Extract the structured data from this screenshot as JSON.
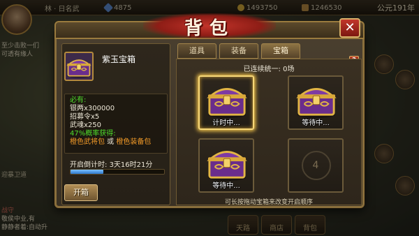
{
  "hud": {
    "resource_gems": "4875",
    "resource_silver": "1493750",
    "resource_grain": "1246530",
    "year": "公元191年",
    "partial_text": "林 · 日名武"
  },
  "background_text": {
    "line1": "至少击败一们",
    "line2": "可透有缘人",
    "line3": "迎暴卫道",
    "line4": "战守",
    "line5": "敬侯中业,有",
    "line6": "静静者着:自动升",
    "btn_a": "天路",
    "btn_b": "商店",
    "btn_c": "背包"
  },
  "panel": {
    "title": "背包",
    "close_label": "✕"
  },
  "detail": {
    "item_name": "紫玉宝箱",
    "must_have_label": "必有:",
    "reward_silver": "银两x300000",
    "reward_recruit": "招募令x5",
    "reward_weapon": "武魂x250",
    "chance_label": "47%概率获得:",
    "chance_option_a": "橙色武将包",
    "chance_or": " 或 ",
    "chance_option_b": "橙色装备包",
    "countdown_label": "开启倒计时:",
    "countdown_value": "3天16时21分",
    "progress_fraction": 0.35,
    "open_button": "开箱"
  },
  "tabs": [
    {
      "label": "道具",
      "active": false
    },
    {
      "label": "装备",
      "active": false
    },
    {
      "label": "宝箱",
      "active": true
    }
  ],
  "help_label": "?",
  "streak_text": "已连续统一: 0场",
  "slots": [
    {
      "status": "计时中...",
      "selected": true,
      "filled": true
    },
    {
      "status": "等待中...",
      "selected": false,
      "filled": true
    },
    {
      "status": "等待中...",
      "selected": false,
      "filled": true
    },
    {
      "status": "4",
      "selected": false,
      "filled": false
    }
  ],
  "hint_text": "可长按拖动宝箱来改变开启顺序",
  "colors": {
    "accent_gold": "#f7d879",
    "chest_purple": "#6a2d8c",
    "chance_green": "#4fdc2c",
    "chance_orange": "#f29a28",
    "close_red": "#c2372b"
  }
}
